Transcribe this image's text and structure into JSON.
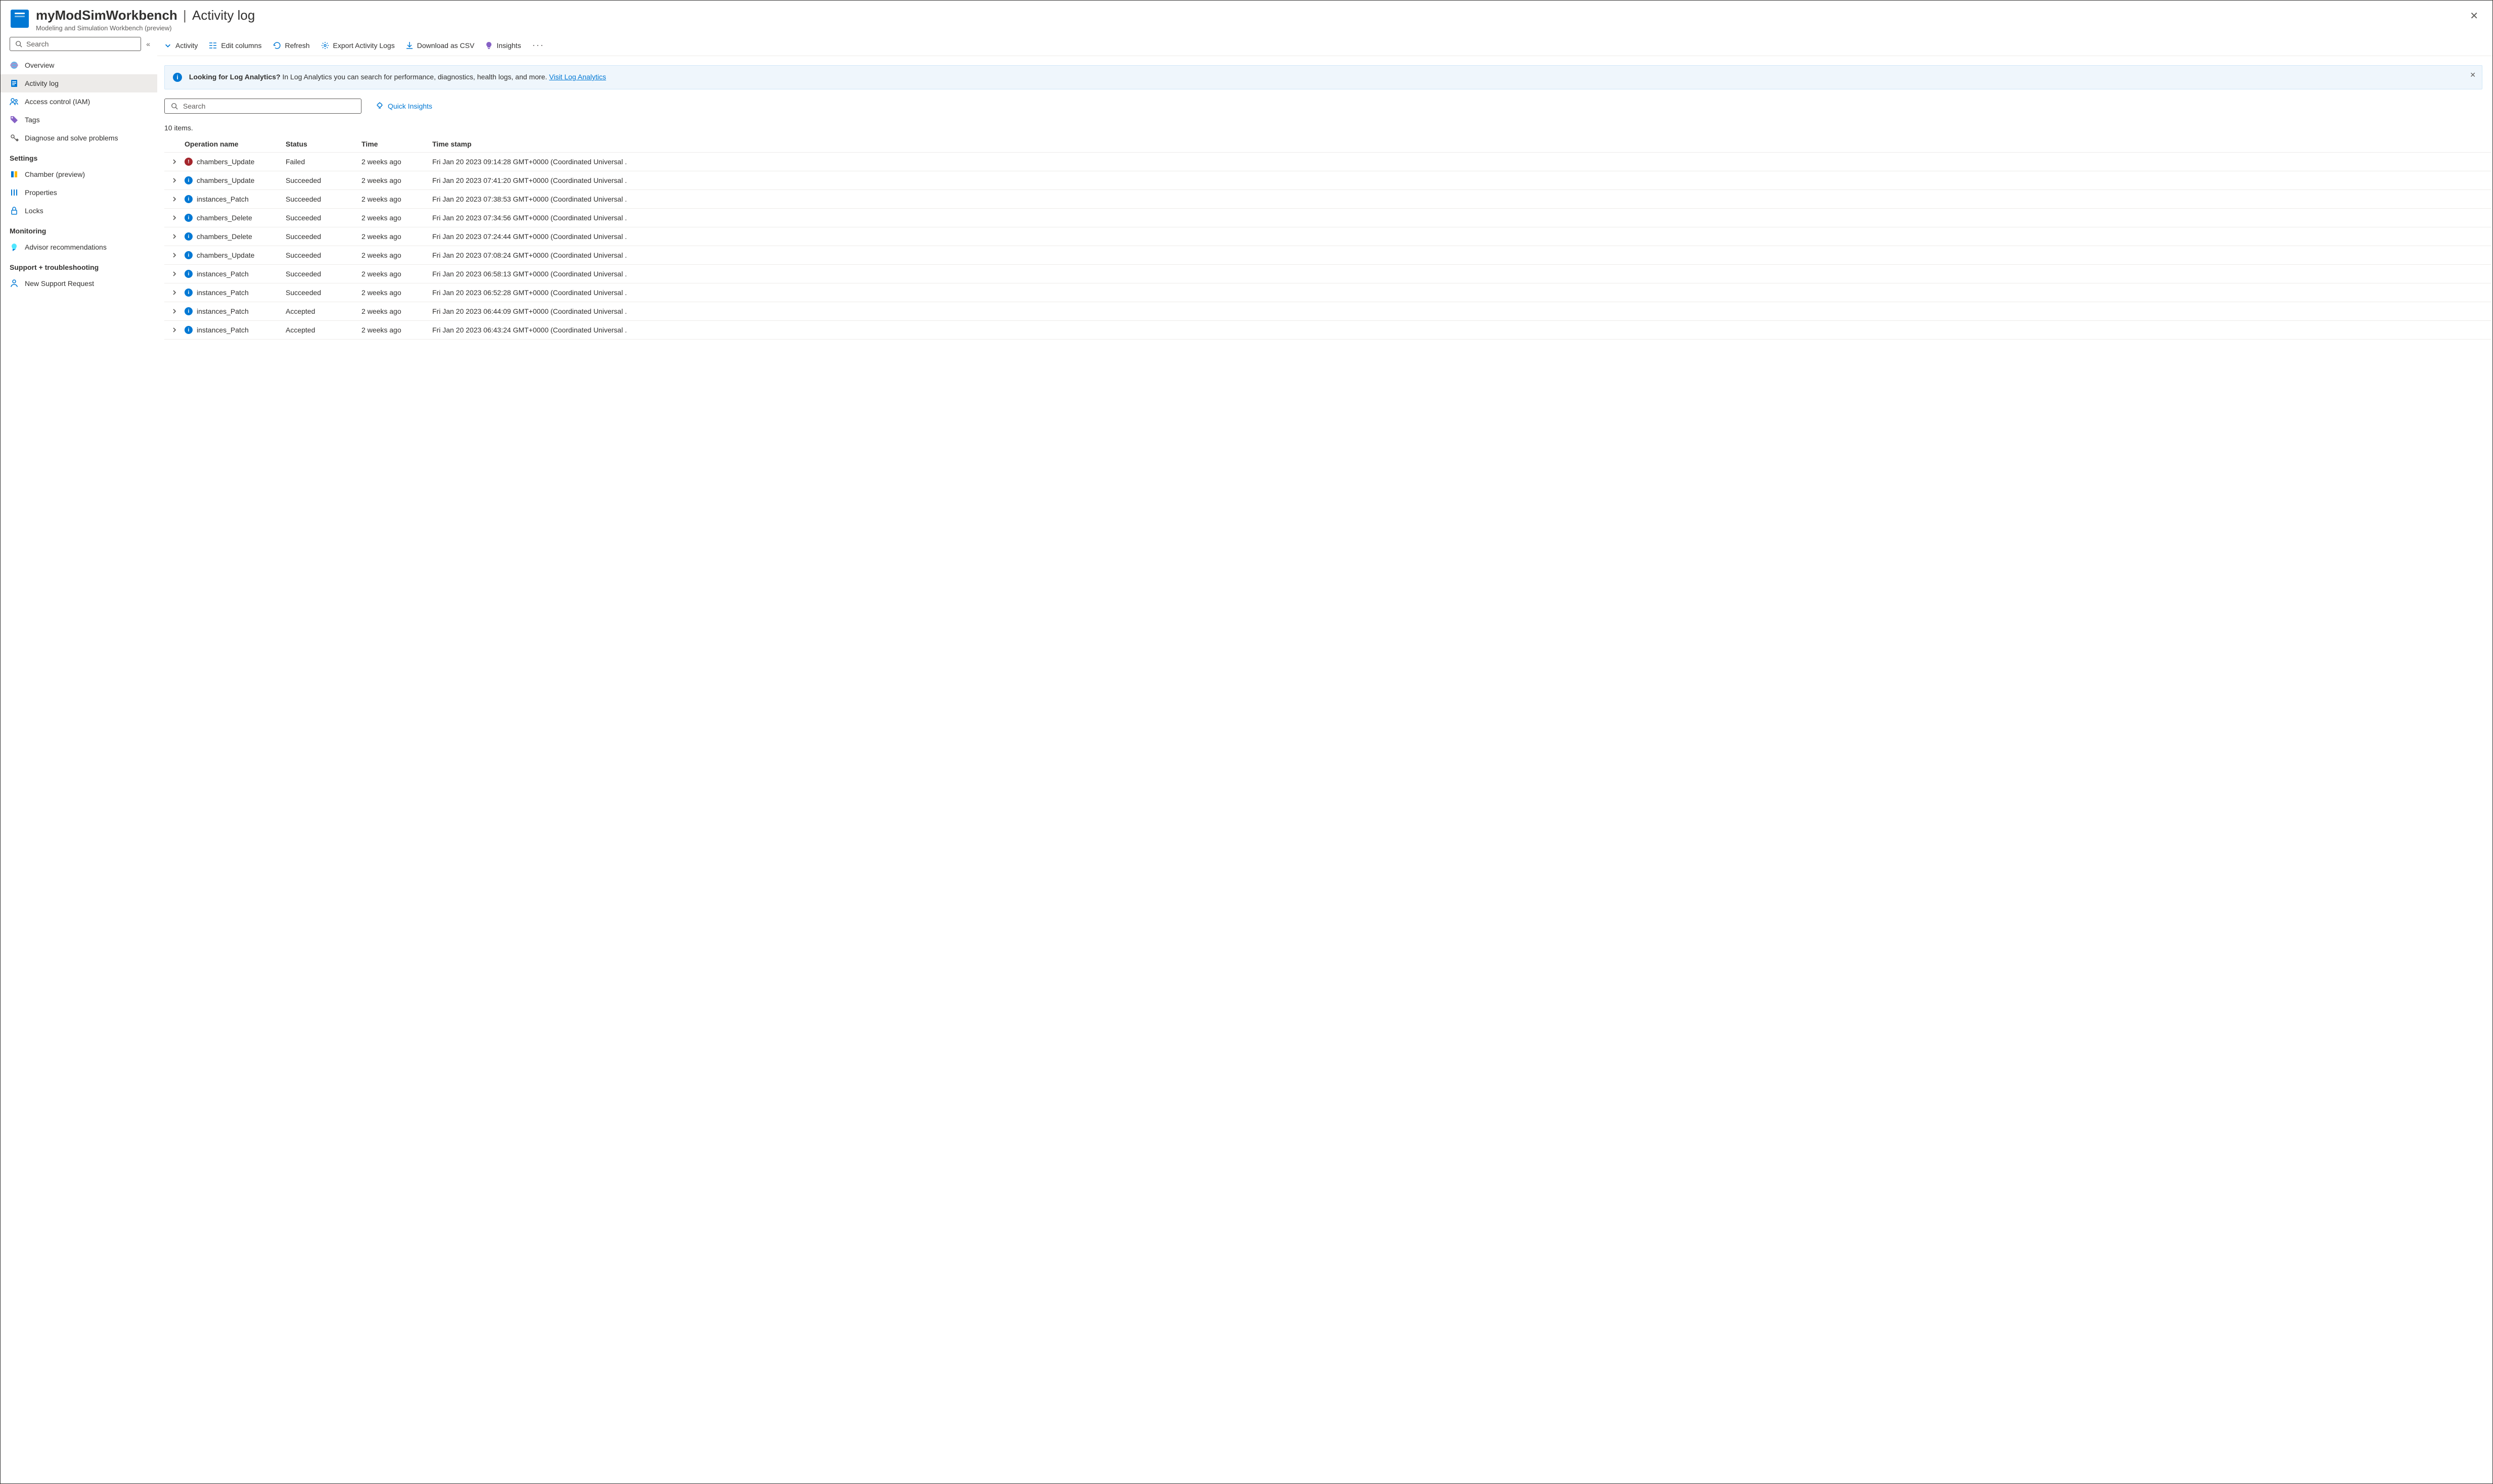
{
  "header": {
    "resource_name": "myModSimWorkbench",
    "separator": "|",
    "page_name": "Activity log",
    "subtitle": "Modeling and Simulation Workbench (preview)"
  },
  "sidebar": {
    "search_placeholder": "Search",
    "items_top": [
      {
        "label": "Overview",
        "name": "overview"
      },
      {
        "label": "Activity log",
        "name": "activity-log"
      },
      {
        "label": "Access control (IAM)",
        "name": "access-control"
      },
      {
        "label": "Tags",
        "name": "tags"
      },
      {
        "label": "Diagnose and solve problems",
        "name": "diagnose"
      }
    ],
    "section_settings": "Settings",
    "items_settings": [
      {
        "label": "Chamber (preview)",
        "name": "chamber"
      },
      {
        "label": "Properties",
        "name": "properties"
      },
      {
        "label": "Locks",
        "name": "locks"
      }
    ],
    "section_monitoring": "Monitoring",
    "items_monitoring": [
      {
        "label": "Advisor recommendations",
        "name": "advisor"
      }
    ],
    "section_support": "Support + troubleshooting",
    "items_support": [
      {
        "label": "New Support Request",
        "name": "support-request"
      }
    ]
  },
  "toolbar": {
    "activity": "Activity",
    "edit_columns": "Edit columns",
    "refresh": "Refresh",
    "export": "Export Activity Logs",
    "download_csv": "Download as CSV",
    "insights": "Insights",
    "more": "···"
  },
  "banner": {
    "title": "Looking for Log Analytics?",
    "body": "In Log Analytics you can search for performance, diagnostics, health logs, and more.",
    "link": "Visit Log Analytics"
  },
  "table_controls": {
    "search_placeholder": "Search",
    "quick_insights": "Quick Insights",
    "items_count": "10 items."
  },
  "table": {
    "headers": {
      "op": "Operation name",
      "status": "Status",
      "time": "Time",
      "timestamp": "Time stamp"
    },
    "rows": [
      {
        "status_kind": "fail",
        "op": "chambers_Update",
        "status": "Failed",
        "time": "2 weeks ago",
        "ts": "Fri Jan 20 2023 09:14:28 GMT+0000 (Coordinated Universal ."
      },
      {
        "status_kind": "info",
        "op": "chambers_Update",
        "status": "Succeeded",
        "time": "2 weeks ago",
        "ts": "Fri Jan 20 2023 07:41:20 GMT+0000 (Coordinated Universal ."
      },
      {
        "status_kind": "info",
        "op": "instances_Patch",
        "status": "Succeeded",
        "time": "2 weeks ago",
        "ts": "Fri Jan 20 2023 07:38:53 GMT+0000 (Coordinated Universal ."
      },
      {
        "status_kind": "info",
        "op": "chambers_Delete",
        "status": "Succeeded",
        "time": "2 weeks ago",
        "ts": "Fri Jan 20 2023 07:34:56 GMT+0000 (Coordinated Universal ."
      },
      {
        "status_kind": "info",
        "op": "chambers_Delete",
        "status": "Succeeded",
        "time": "2 weeks ago",
        "ts": "Fri Jan 20 2023 07:24:44 GMT+0000 (Coordinated Universal ."
      },
      {
        "status_kind": "info",
        "op": "chambers_Update",
        "status": "Succeeded",
        "time": "2 weeks ago",
        "ts": "Fri Jan 20 2023 07:08:24 GMT+0000 (Coordinated Universal ."
      },
      {
        "status_kind": "info",
        "op": "instances_Patch",
        "status": "Succeeded",
        "time": "2 weeks ago",
        "ts": "Fri Jan 20 2023 06:58:13 GMT+0000 (Coordinated Universal ."
      },
      {
        "status_kind": "info",
        "op": "instances_Patch",
        "status": "Succeeded",
        "time": "2 weeks ago",
        "ts": "Fri Jan 20 2023 06:52:28 GMT+0000 (Coordinated Universal ."
      },
      {
        "status_kind": "info",
        "op": "instances_Patch",
        "status": "Accepted",
        "time": "2 weeks ago",
        "ts": "Fri Jan 20 2023 06:44:09 GMT+0000 (Coordinated Universal ."
      },
      {
        "status_kind": "info",
        "op": "instances_Patch",
        "status": "Accepted",
        "time": "2 weeks ago",
        "ts": "Fri Jan 20 2023 06:43:24 GMT+0000 (Coordinated Universal ."
      }
    ]
  },
  "colors": {
    "accent": "#0078d4",
    "fail": "#a4262c"
  }
}
